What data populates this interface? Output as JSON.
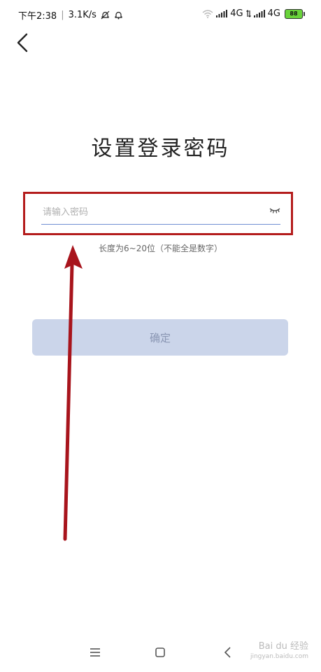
{
  "status_bar": {
    "time": "下午2:38",
    "speed": "3.1K/s",
    "network1": "4G",
    "network2": "4G",
    "battery": "88"
  },
  "page": {
    "title": "设置登录密码"
  },
  "password_field": {
    "placeholder": "请输入密码",
    "value": ""
  },
  "hint": "长度为6~20位（不能全是数字）",
  "confirm_button": {
    "label": "确定"
  },
  "annotation": {
    "highlight_color": "#b41c1c"
  },
  "watermark": {
    "text": "Bai du 经验",
    "url": "jingyan.baidu.com"
  },
  "colors": {
    "accent": "#6f8fd2",
    "button_bg": "#cbd5ea",
    "button_text": "#8a96b3"
  }
}
